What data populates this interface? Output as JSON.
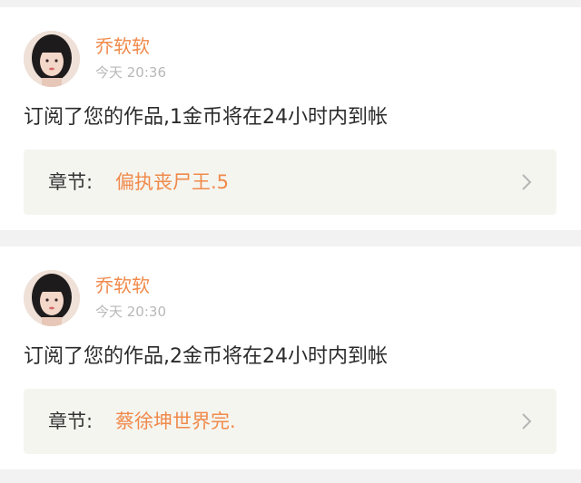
{
  "notifications": [
    {
      "username": "乔软软",
      "time": "今天 20:36",
      "message": "订阅了您的作品,1金币将在24小时内到帐",
      "chapter_label": "章节:",
      "chapter_title": "偏执丧尸王.5",
      "avatar_icon": "user-avatar",
      "arrow_icon": "chevron-right-icon"
    },
    {
      "username": "乔软软",
      "time": "今天 20:30",
      "message": "订阅了您的作品,2金币将在24小时内到帐",
      "chapter_label": "章节:",
      "chapter_title": "蔡徐坤世界完.",
      "avatar_icon": "user-avatar",
      "arrow_icon": "chevron-right-icon"
    }
  ],
  "colors": {
    "accent": "#f08a4b",
    "background": "#f2f2f2",
    "card": "#ffffff",
    "chapter_box": "#f5f5f0",
    "timestamp": "#b8b8b8",
    "text": "#2b2b2b"
  }
}
